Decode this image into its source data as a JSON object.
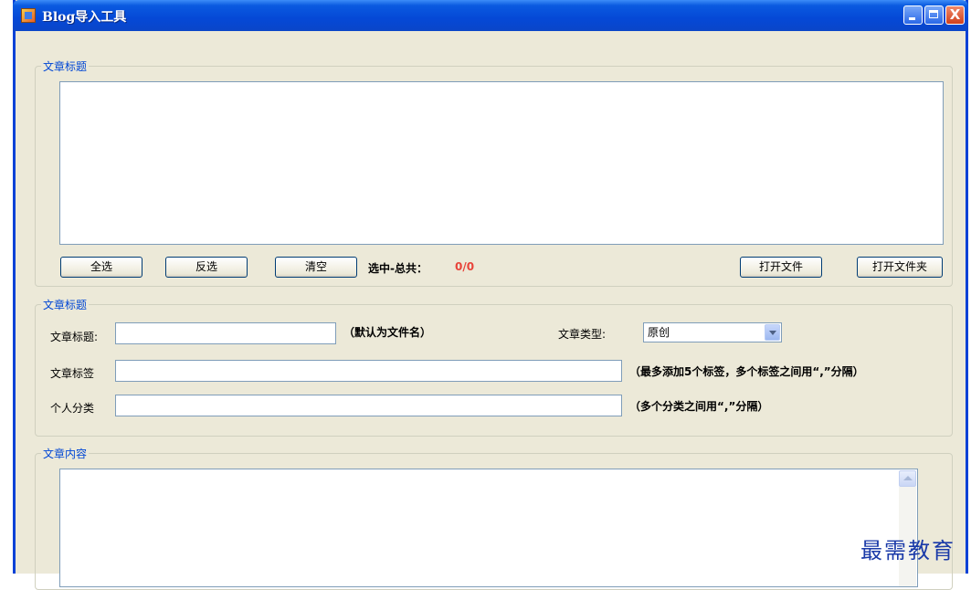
{
  "window": {
    "title": "Blog导入工具",
    "close_glyph": "X"
  },
  "file_group": {
    "legend": "文章标题",
    "select_all": "全选",
    "invert_select": "反选",
    "clear": "清空",
    "count_label": "选中-总共：",
    "count_value": "0/0",
    "open_file": "打开文件",
    "open_folder": "打开文件夹"
  },
  "meta_group": {
    "legend": "文章标题",
    "title_label": "文章标题:",
    "title_value": "",
    "title_hint": "（默认为文件名）",
    "type_label": "文章类型:",
    "type_value": "原创",
    "tags_label": "文章标签",
    "tags_value": "",
    "tags_hint": "（最多添加5个标签，多个标签之间用“,”分隔）",
    "category_label": "个人分类",
    "category_value": "",
    "category_hint": "（多个分类之间用“,”分隔）"
  },
  "content_group": {
    "legend": "文章内容"
  },
  "watermark": "最需教育"
}
